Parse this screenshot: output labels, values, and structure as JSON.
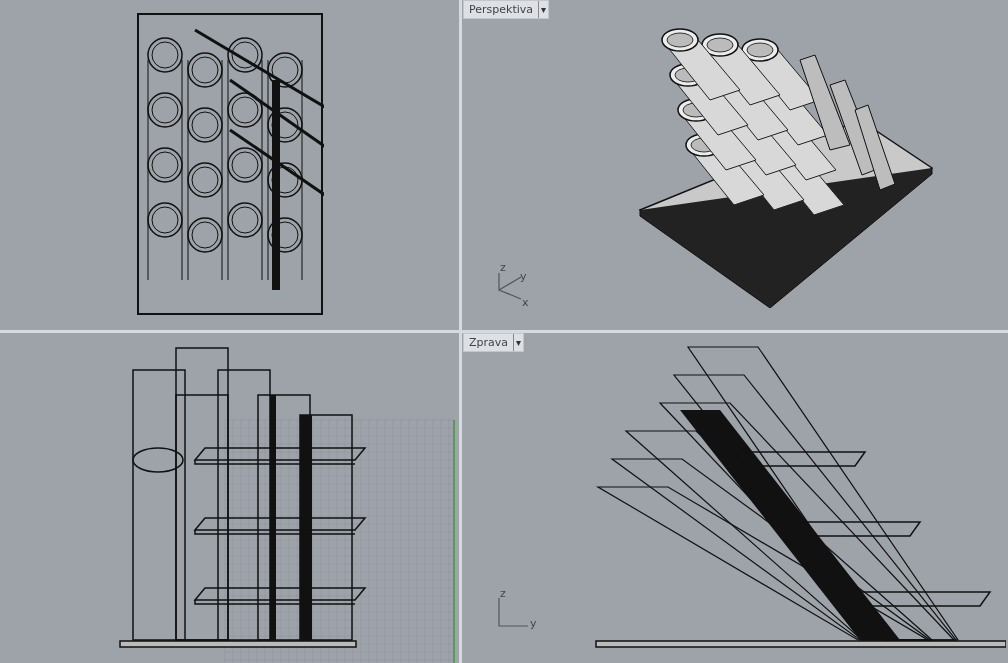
{
  "viewports": [
    {
      "kind": "top"
    },
    {
      "kind": "perspective",
      "title": "Perspektiva",
      "menu_glyph": "▾",
      "axes": [
        "z",
        "y",
        "x"
      ]
    },
    {
      "kind": "front"
    },
    {
      "kind": "right",
      "title": "Zprava",
      "menu_glyph": "▾",
      "axes": [
        "z",
        "y"
      ]
    }
  ]
}
